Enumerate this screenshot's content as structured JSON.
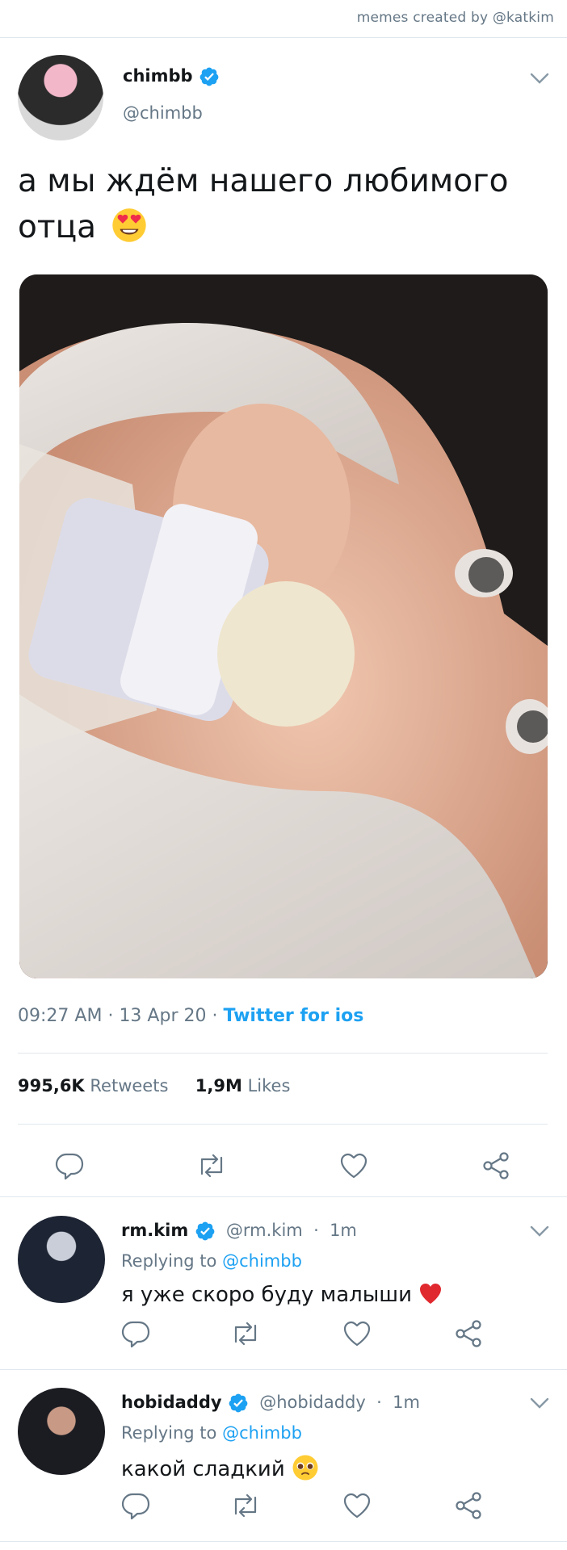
{
  "credit": "memes created by @katkim",
  "tweet": {
    "name": "chimbb",
    "handle": "@chimbb",
    "text": "а мы ждём нашего любимого отца",
    "time": "09:27 AM",
    "date": "13 Apr 20",
    "source": "Twitter for ios",
    "retweets_count": "995,6K",
    "retweets_label": "Retweets",
    "likes_count": "1,9M",
    "likes_label": "Likes"
  },
  "replies": [
    {
      "name": "rm.kim",
      "handle": "@rm.kim",
      "time": "1m",
      "replying_prefix": "Replying to",
      "replying_to": "@chimbb",
      "text": "я уже скоро буду малыши",
      "emoji": "red-heart"
    },
    {
      "name": "hobidaddy",
      "handle": "@hobidaddy",
      "time": "1m",
      "replying_prefix": "Replying to",
      "replying_to": "@chimbb",
      "text": "какой сладкий",
      "emoji": "pleading-face"
    }
  ],
  "colors": {
    "accent": "#1da1f2",
    "muted": "#657786",
    "text": "#14171a",
    "divider": "#e1e8ed"
  },
  "icons": [
    "verified-badge-icon",
    "chevron-down-icon",
    "reply-icon",
    "retweet-icon",
    "like-icon",
    "share-icon",
    "heart-eyes-emoji-icon"
  ]
}
